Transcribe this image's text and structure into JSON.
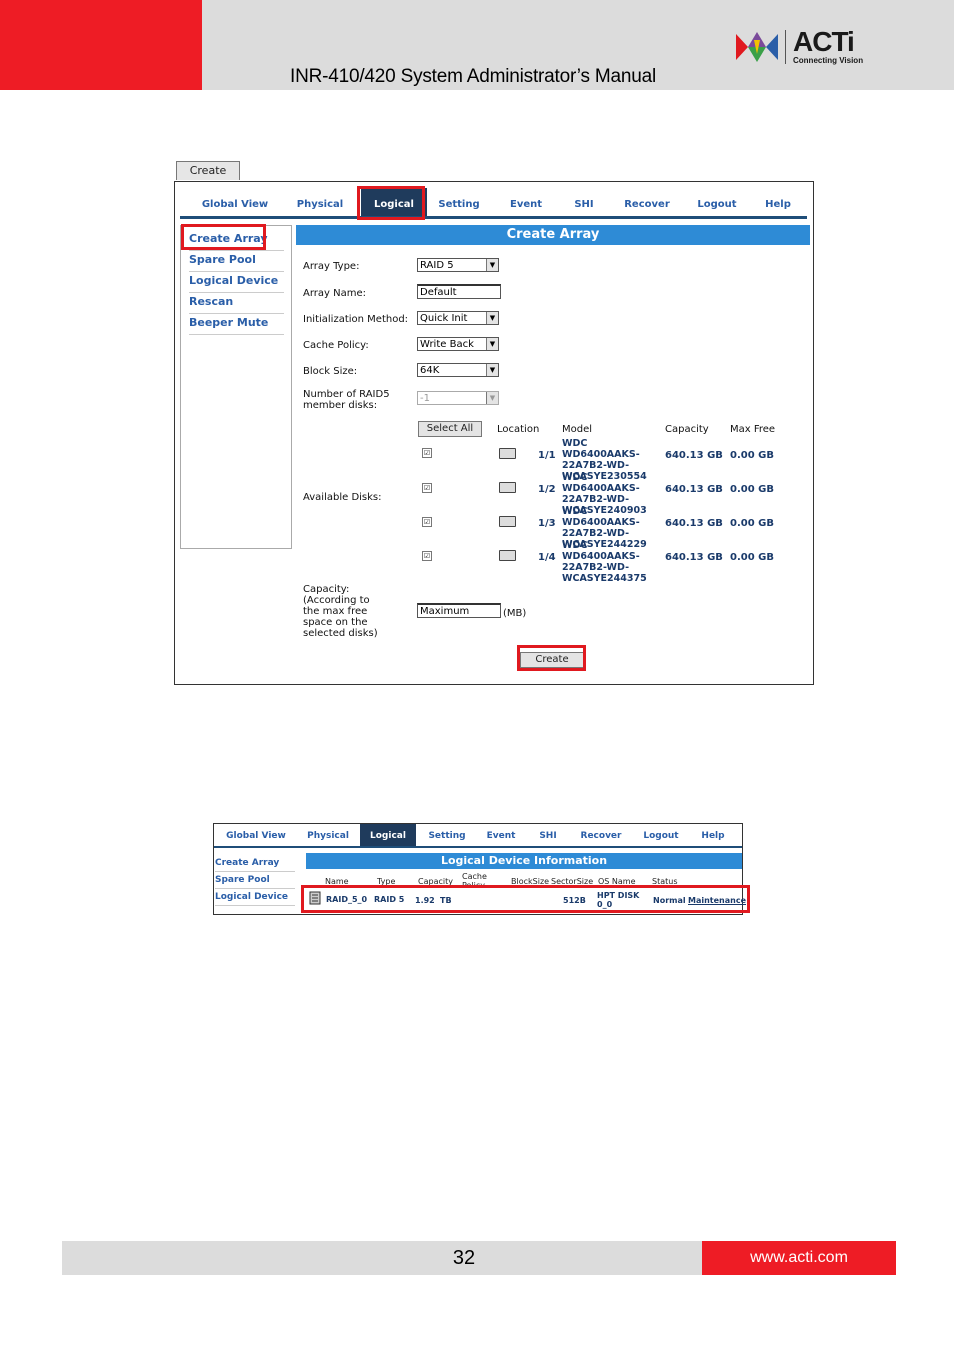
{
  "header": {
    "title": "INR-410/420 System Administrator’s Manual",
    "logo_text": "ACTi",
    "logo_tagline": "Connecting Vision"
  },
  "screenshot1": {
    "top_tab": "Create",
    "nav": [
      "Global View",
      "Physical",
      "Logical",
      "Setting",
      "Event",
      "SHI",
      "Recover",
      "Logout",
      "Help"
    ],
    "active_nav": "Logical",
    "sidebar": [
      "Create Array",
      "Spare Pool",
      "Logical Device",
      "Rescan",
      "Beeper Mute"
    ],
    "form_title": "Create Array",
    "fields": {
      "array_type_label": "Array Type:",
      "array_type_value": "RAID 5",
      "array_name_label": "Array Name:",
      "array_name_value": "Default",
      "init_method_label": "Initialization Method:",
      "init_method_value": "Quick Init",
      "cache_policy_label": "Cache Policy:",
      "cache_policy_value": "Write Back",
      "block_size_label": "Block Size:",
      "block_size_value": "64K",
      "members_label_1": "Number of RAID5",
      "members_label_2": "member disks:",
      "members_value": "-1"
    },
    "disks": {
      "label": "Available Disks:",
      "select_all": "Select All",
      "columns": [
        "Location",
        "Model",
        "Capacity",
        "Max Free"
      ],
      "rows": [
        {
          "location": "1/1",
          "model": [
            "WDC WD6400AAKS-",
            "22A7B2-WD-",
            "WCASYE230554"
          ],
          "capacity": "640.13 GB",
          "max_free": "0.00 GB",
          "check": "☑"
        },
        {
          "location": "1/2",
          "model": [
            "WDC WD6400AAKS-",
            "22A7B2-WD-",
            "WCASYE240903"
          ],
          "capacity": "640.13 GB",
          "max_free": "0.00 GB",
          "check": "☑"
        },
        {
          "location": "1/3",
          "model": [
            "WDC WD6400AAKS-",
            "22A7B2-WD-",
            "WCASYE244229"
          ],
          "capacity": "640.13 GB",
          "max_free": "0.00 GB",
          "check": "☑"
        },
        {
          "location": "1/4",
          "model": [
            "WDC WD6400AAKS-",
            "22A7B2-WD-",
            "WCASYE244375"
          ],
          "capacity": "640.13 GB",
          "max_free": "0.00 GB",
          "check": "☑"
        }
      ]
    },
    "capacity": {
      "label_lines": [
        "Capacity:",
        "(According to",
        "the max free",
        "space on the",
        "selected disks)"
      ],
      "value": "Maximum",
      "unit": "(MB)"
    },
    "create_button": "Create"
  },
  "screenshot2": {
    "nav": [
      "Global View",
      "Physical",
      "Logical",
      "Setting",
      "Event",
      "SHI",
      "Recover",
      "Logout",
      "Help"
    ],
    "sidebar": [
      "Create Array",
      "Spare Pool",
      "Logical Device"
    ],
    "title": "Logical Device Information",
    "columns": {
      "name": "Name",
      "type": "Type",
      "capacity": "Capacity",
      "cache1": "Cache",
      "cache2": "Policy",
      "blocksize": "BlockSize",
      "sectorsize": "SectorSize",
      "osname": "OS Name",
      "status": "Status"
    },
    "row": {
      "name": "RAID_5_0",
      "type": "RAID 5",
      "capacity": "1.92",
      "cap_unit": "TB",
      "sectorsize": "512B",
      "os1": "HPT DISK",
      "os2": "0_0",
      "status": "Normal",
      "action": "Maintenance"
    }
  },
  "footer": {
    "page_number": "32",
    "url": "www.acti.com"
  }
}
